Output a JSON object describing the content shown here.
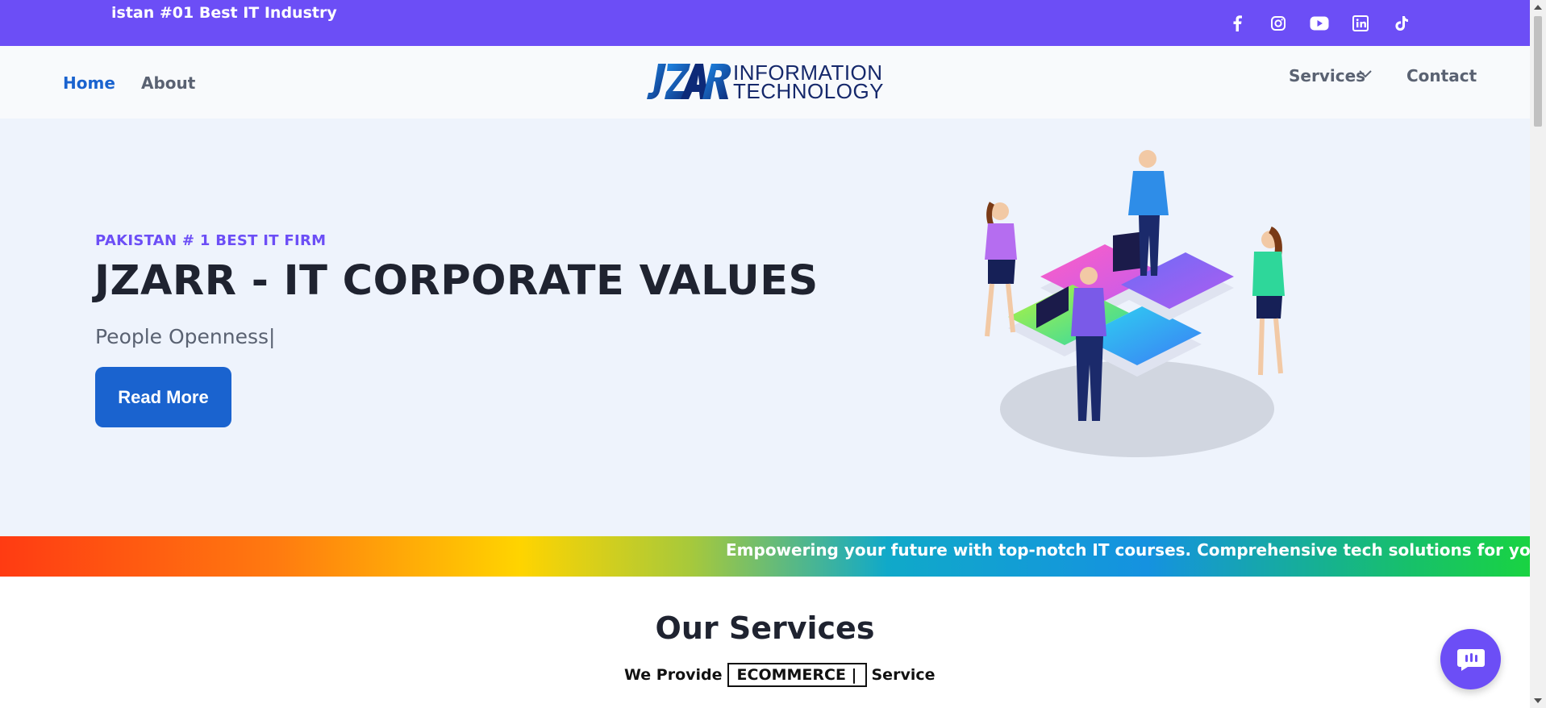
{
  "topbar": {
    "marquee": "istan #01 Best IT Industry",
    "socials": [
      "facebook-icon",
      "instagram-icon",
      "youtube-icon",
      "linkedin-icon",
      "tiktok-icon"
    ],
    "bg_color": "#6c4ef6"
  },
  "nav": {
    "home": "Home",
    "about": "About",
    "services": "Services",
    "contact": "Contact",
    "active_color": "#1a63cf"
  },
  "logo": {
    "mark": "JZAR",
    "line1": "INFORMATION",
    "line2": "TECHNOLOGY"
  },
  "hero": {
    "kicker": "PAKISTAN # 1 BEST IT FIRM",
    "headline": "JZARR - IT CORPORATE VALUES",
    "typed": "People Openness|",
    "button": "Read More"
  },
  "ticker": {
    "text": "Empowering your future with top-notch IT courses. Comprehensive tech solutions for your business. Crafting c"
  },
  "services": {
    "title": "Our Services",
    "provide_prefix": "We Provide",
    "provide_word": "ECOMMERCE |",
    "provide_suffix": "Service"
  },
  "chat": {
    "icon": "chat-bubble-icon"
  }
}
